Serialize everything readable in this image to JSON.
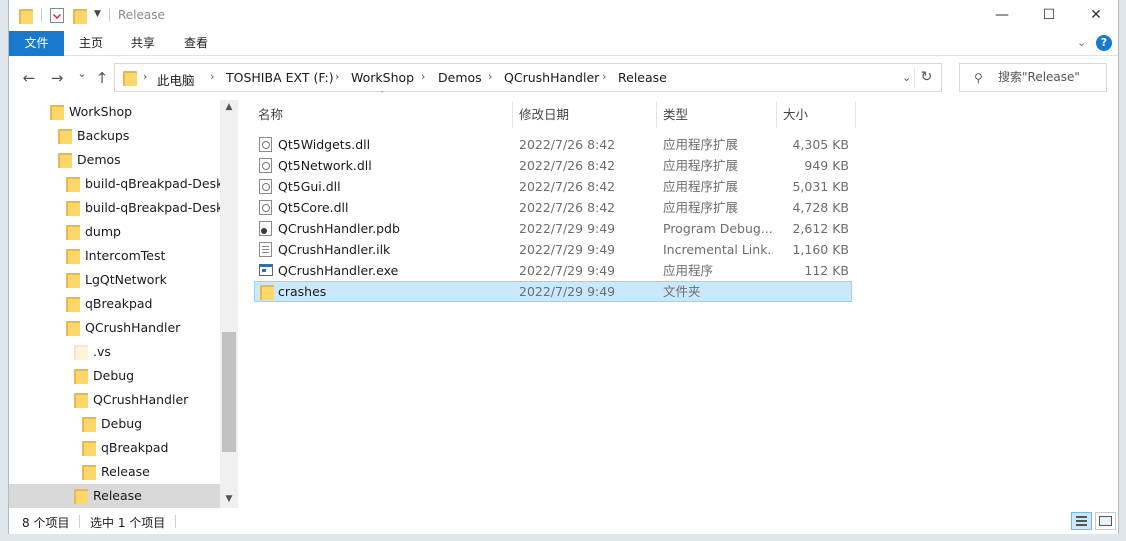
{
  "window": {
    "title": "Release",
    "controls": {
      "minimize": "—",
      "maximize": "☐",
      "close": "✕"
    }
  },
  "ribbon": {
    "tabs": [
      "文件",
      "主页",
      "共享",
      "查看"
    ],
    "expand_icon": "chevron-down-icon",
    "help_label": "?"
  },
  "nav": {
    "back": "←",
    "forward": "→",
    "recent": "⌄",
    "up": "↑",
    "breadcrumb": [
      "此电脑",
      "TOSHIBA EXT (F:)",
      "WorkShop",
      "Demos",
      "QCrushHandler",
      "Release"
    ],
    "search_placeholder": "搜索\"Release\""
  },
  "tree": {
    "items": [
      {
        "label": "WorkShop"
      },
      {
        "label": "Backups"
      },
      {
        "label": "Demos"
      },
      {
        "label": "build-qBreakpad-Desk"
      },
      {
        "label": "build-qBreakpad-Desk"
      },
      {
        "label": "dump"
      },
      {
        "label": "IntercomTest"
      },
      {
        "label": "LgQtNetwork"
      },
      {
        "label": "qBreakpad"
      },
      {
        "label": "QCrushHandler"
      },
      {
        "label": ".vs"
      },
      {
        "label": "Debug"
      },
      {
        "label": "QCrushHandler"
      },
      {
        "label": "Debug"
      },
      {
        "label": "qBreakpad"
      },
      {
        "label": "Release"
      },
      {
        "label": "Release"
      }
    ]
  },
  "list": {
    "columns": [
      "名称",
      "修改日期",
      "类型",
      "大小"
    ],
    "files": [
      {
        "name": "Qt5Widgets.dll",
        "date": "2022/7/26 8:42",
        "type": "应用程序扩展",
        "size": "4,305 KB",
        "icon": "dll-file-icon"
      },
      {
        "name": "Qt5Network.dll",
        "date": "2022/7/26 8:42",
        "type": "应用程序扩展",
        "size": "949 KB",
        "icon": "dll-file-icon"
      },
      {
        "name": "Qt5Gui.dll",
        "date": "2022/7/26 8:42",
        "type": "应用程序扩展",
        "size": "5,031 KB",
        "icon": "dll-file-icon"
      },
      {
        "name": "Qt5Core.dll",
        "date": "2022/7/26 8:42",
        "type": "应用程序扩展",
        "size": "4,728 KB",
        "icon": "dll-file-icon"
      },
      {
        "name": "QCrushHandler.pdb",
        "date": "2022/7/29 9:49",
        "type": "Program Debug...",
        "size": "2,612 KB",
        "icon": "pdb-file-icon"
      },
      {
        "name": "QCrushHandler.ilk",
        "date": "2022/7/29 9:49",
        "type": "Incremental Link...",
        "size": "1,160 KB",
        "icon": "ilk-file-icon"
      },
      {
        "name": "QCrushHandler.exe",
        "date": "2022/7/29 9:49",
        "type": "应用程序",
        "size": "112 KB",
        "icon": "exe-file-icon"
      },
      {
        "name": "crashes",
        "date": "2022/7/29 9:49",
        "type": "文件夹",
        "size": "",
        "icon": "folder-icon"
      }
    ]
  },
  "status": {
    "item_count": "8 个项目",
    "selection": "选中 1 个项目"
  },
  "colors": {
    "accent": "#1979ca",
    "selection": "#cce8ff",
    "folder": "#fcd769"
  }
}
